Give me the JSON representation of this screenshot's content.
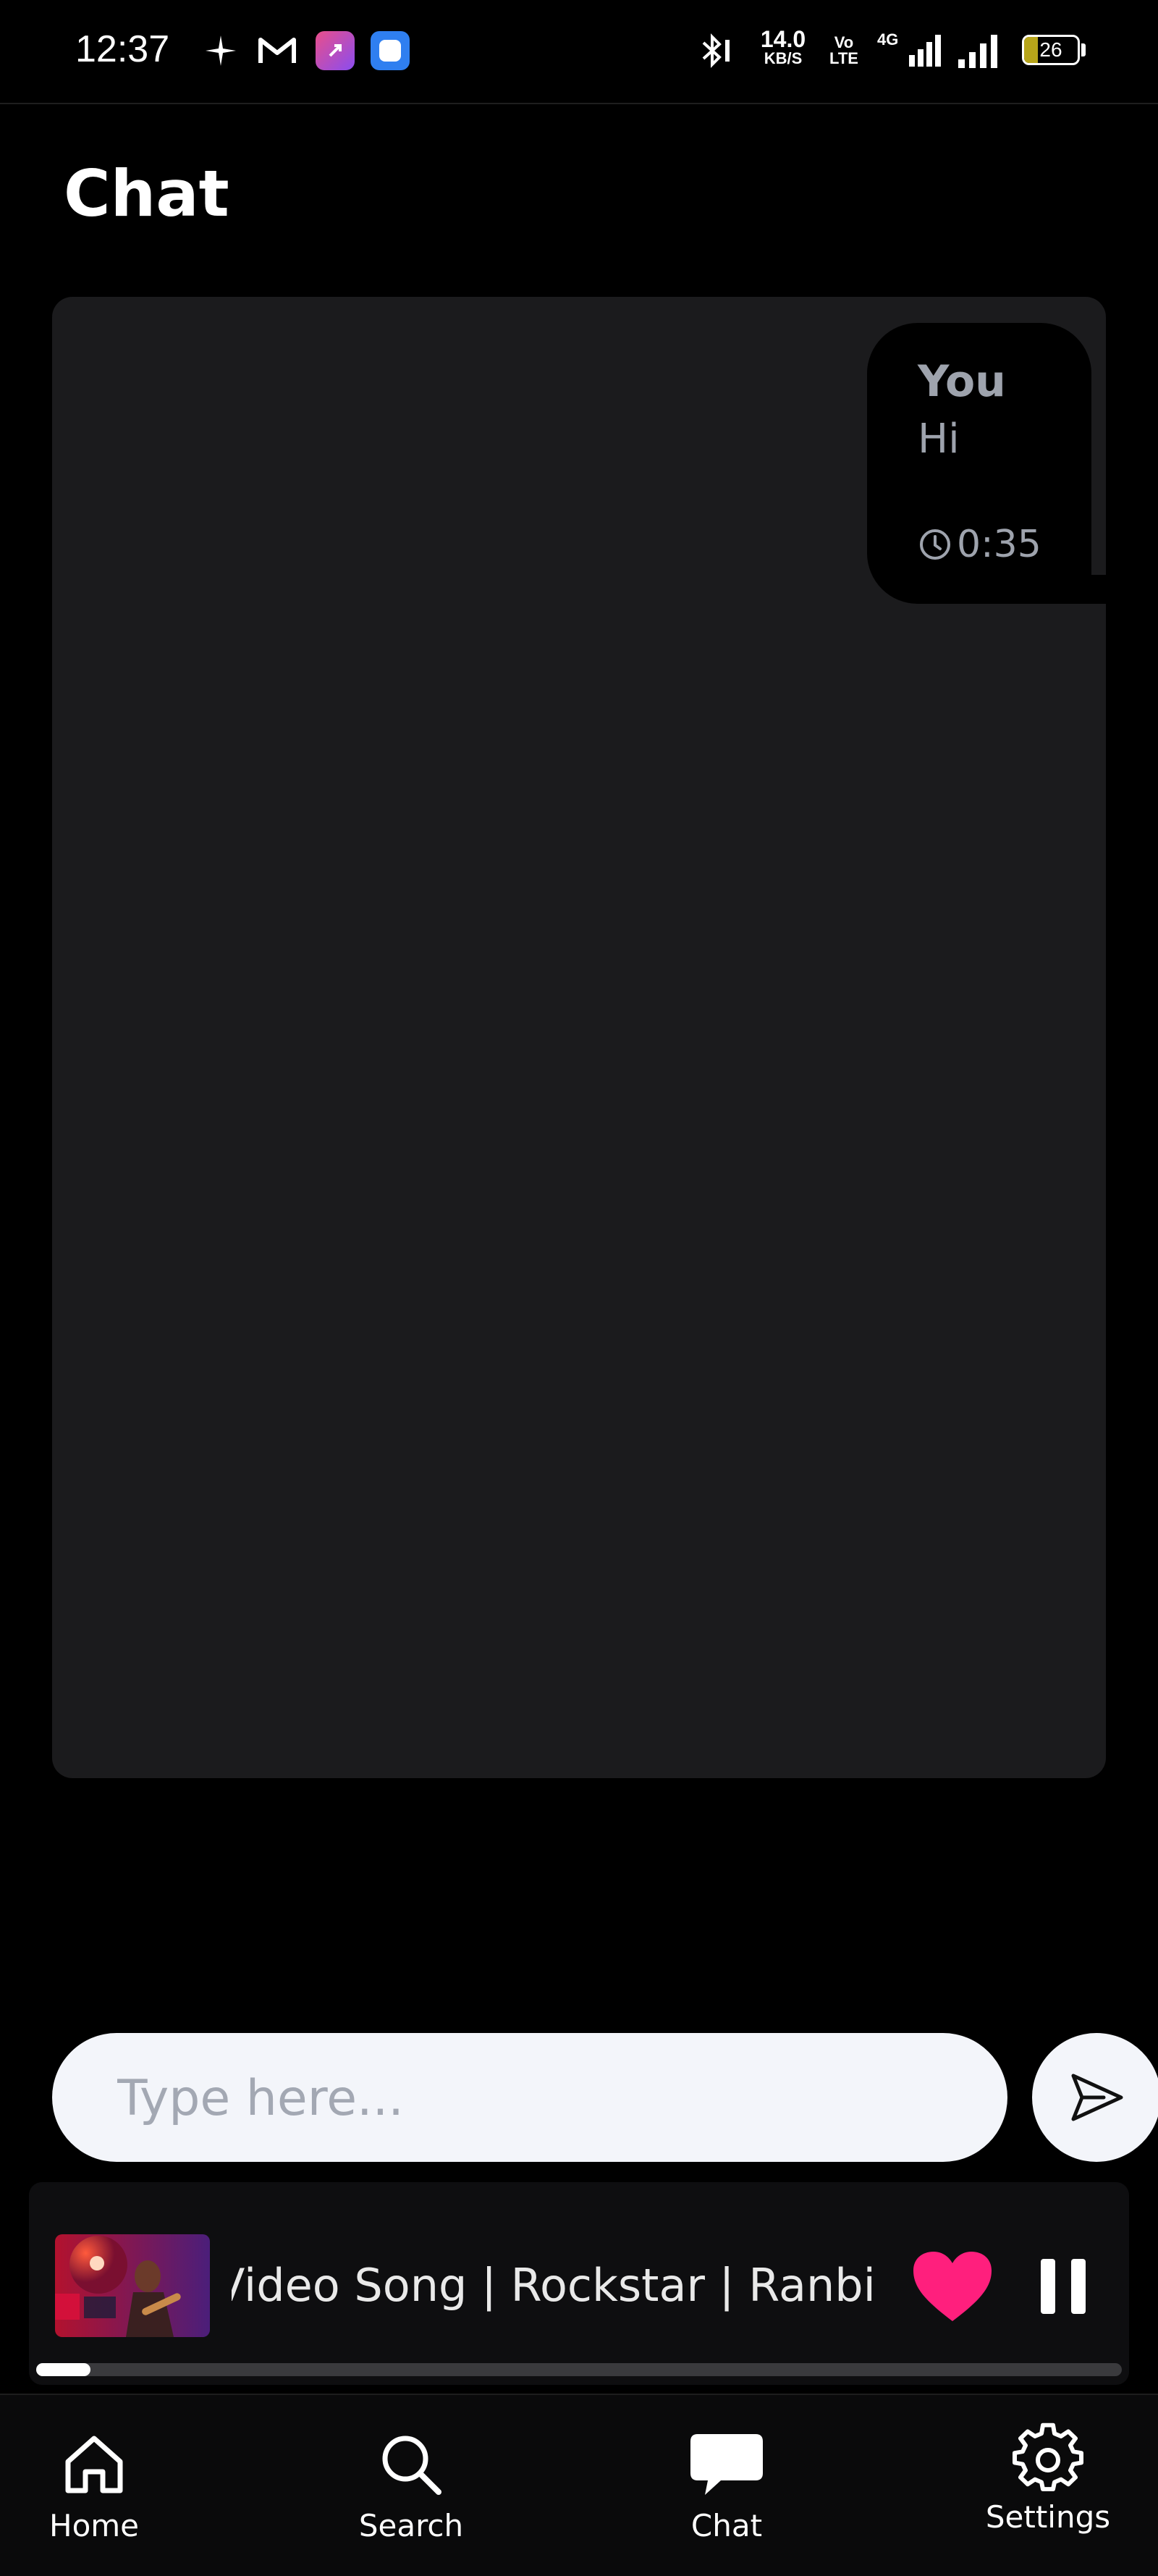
{
  "status_bar": {
    "time": "12:37",
    "net_speed_value": "14.0",
    "net_speed_unit": "KB/S",
    "volte": "Vo LTE",
    "network": "4G",
    "battery_percent": 26,
    "battery_label": "26",
    "icons": [
      "sparkle-icon",
      "gmail-icon",
      "app-badge-pink-icon",
      "app-badge-blue-icon",
      "bluetooth-icon",
      "signal-icon",
      "signal-icon"
    ]
  },
  "page": {
    "title": "Chat"
  },
  "messages": [
    {
      "sender": "You",
      "text": "Hi",
      "time": "0:35"
    }
  ],
  "composer": {
    "placeholder": "Type here...",
    "value": ""
  },
  "player": {
    "title": "Video Song | Rockstar | Ranbi",
    "progress_fraction": 0.05,
    "liked": true,
    "state": "playing",
    "accent": "#ff1f7d"
  },
  "nav": {
    "items": [
      {
        "label": "Home",
        "icon": "home-icon"
      },
      {
        "label": "Search",
        "icon": "search-icon"
      },
      {
        "label": "Chat",
        "icon": "chat-bubble-icon",
        "active": true
      },
      {
        "label": "Settings",
        "icon": "gear-icon"
      }
    ]
  },
  "colors": {
    "background": "#000000",
    "panel": "#1b1b1d",
    "input_bg": "#f3f5fa",
    "muted_text": "#9ea3ad",
    "heart": "#ff1f7d"
  }
}
